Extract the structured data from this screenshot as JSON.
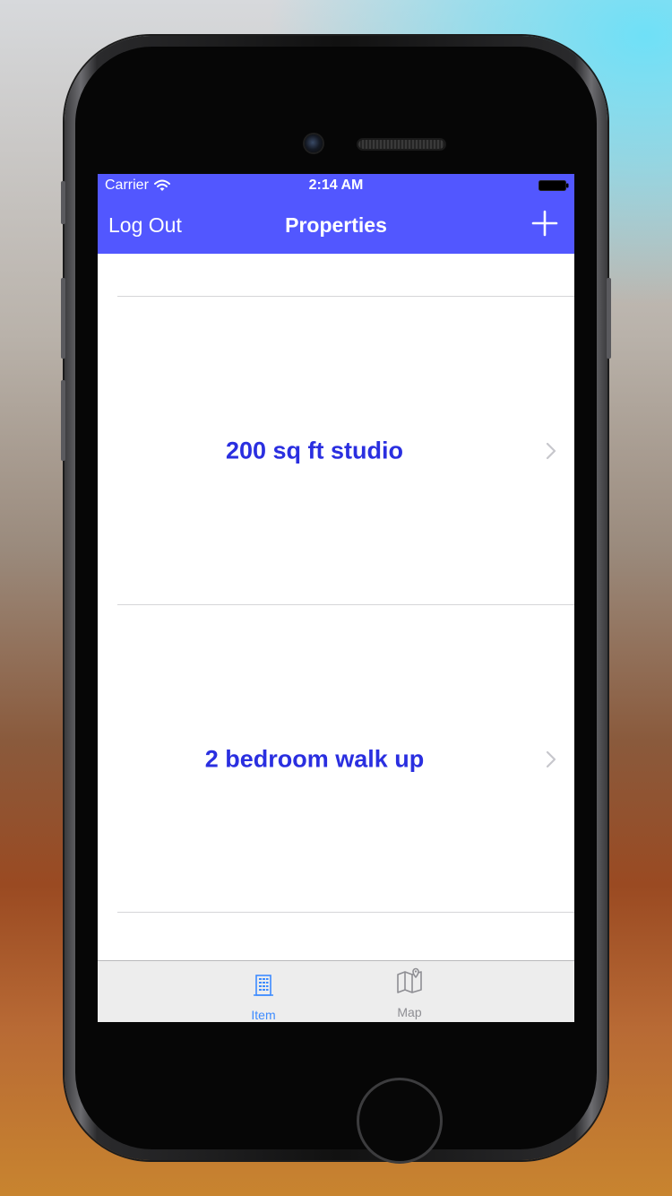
{
  "colors": {
    "accent": "#5257ff",
    "row_text": "#2a2fe0",
    "tab_active": "#3d8bff",
    "tab_inactive": "#8e8e93",
    "chevron": "#c7c7cc"
  },
  "status_bar": {
    "carrier": "Carrier",
    "time": "2:14 AM"
  },
  "nav": {
    "left_button": "Log Out",
    "title": "Properties",
    "right_icon": "plus-icon"
  },
  "properties": [
    {
      "title": "200 sq ft studio"
    },
    {
      "title": "2 bedroom walk up"
    }
  ],
  "tabs": [
    {
      "label": "Item",
      "icon": "building-icon",
      "active": true
    },
    {
      "label": "Map",
      "icon": "map-icon",
      "active": false
    }
  ]
}
